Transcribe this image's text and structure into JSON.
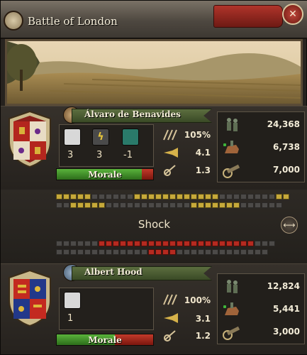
{
  "window": {
    "title": "Battle of London",
    "close_icon": "close-icon"
  },
  "attacker": {
    "commander": "Álvaro de Benavides",
    "pips": {
      "fire": "3",
      "shock": "3",
      "maneuver": "-1"
    },
    "stats": {
      "discipline": "105%",
      "offense": "4.1",
      "defense": "1.3"
    },
    "troops": {
      "infantry": "24,368",
      "cavalry": "6,738",
      "artillery": "7,000"
    },
    "morale_label": "Morale",
    "morale_level": 0.88
  },
  "battle": {
    "phase": "Shock",
    "attacker_front": "YYYYYEEEEEEYYYYYYYYYYYYEEEEEEEEYY",
    "attacker_back": "EEYYYYYEEEEEEEEEEEEYYYYYYYEEEEEE",
    "defender_front": "EEEEEERRRRRRRRRRRRRRRRRRRRRREEE",
    "defender_back": "EEEEEEEEEEEEERRRREEEEEEEEEEEEE"
  },
  "defender": {
    "commander": "Albert Hood",
    "pips": {
      "fire": "1"
    },
    "stats": {
      "discipline": "100%",
      "offense": "3.1",
      "defense": "1.2"
    },
    "troops": {
      "infantry": "12,824",
      "cavalry": "5,441",
      "artillery": "3,000"
    },
    "morale_label": "Morale",
    "morale_level": 0.6
  },
  "colors": {
    "morale_green": "#3f8f2a",
    "morale_red": "#a82a1e",
    "unit_yellow": "#c6a93a",
    "unit_red": "#b52a20",
    "ribbon_green": "#4a5a30"
  }
}
